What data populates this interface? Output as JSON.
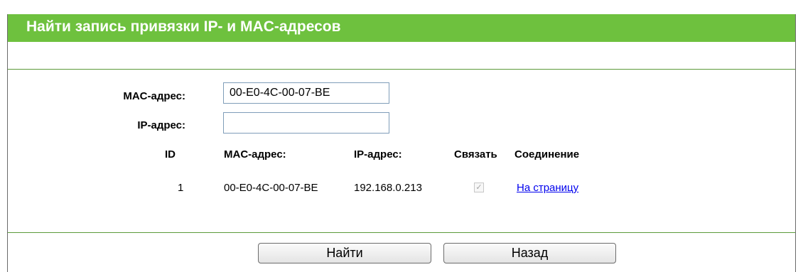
{
  "title": "Найти запись привязки IP- и MAC-адресов",
  "form": {
    "mac_label": "MAC-адрес:",
    "mac_value": "00-E0-4C-00-07-BE",
    "ip_label": "IP-адрес:",
    "ip_value": ""
  },
  "table": {
    "headers": {
      "id": "ID",
      "mac": "MAC-адрес:",
      "ip": "IP-адрес:",
      "bind": "Связать",
      "link": "Соединение"
    },
    "rows": [
      {
        "id": "1",
        "mac": "00-E0-4C-00-07-BE",
        "ip": "192.168.0.213",
        "bind_checked": true,
        "link_label": "На страницу"
      }
    ]
  },
  "buttons": {
    "find": "Найти",
    "back": "Назад"
  },
  "colors": {
    "title_bar": "#6ec13e",
    "divider": "#5b9a3a",
    "link": "#0000ee"
  }
}
